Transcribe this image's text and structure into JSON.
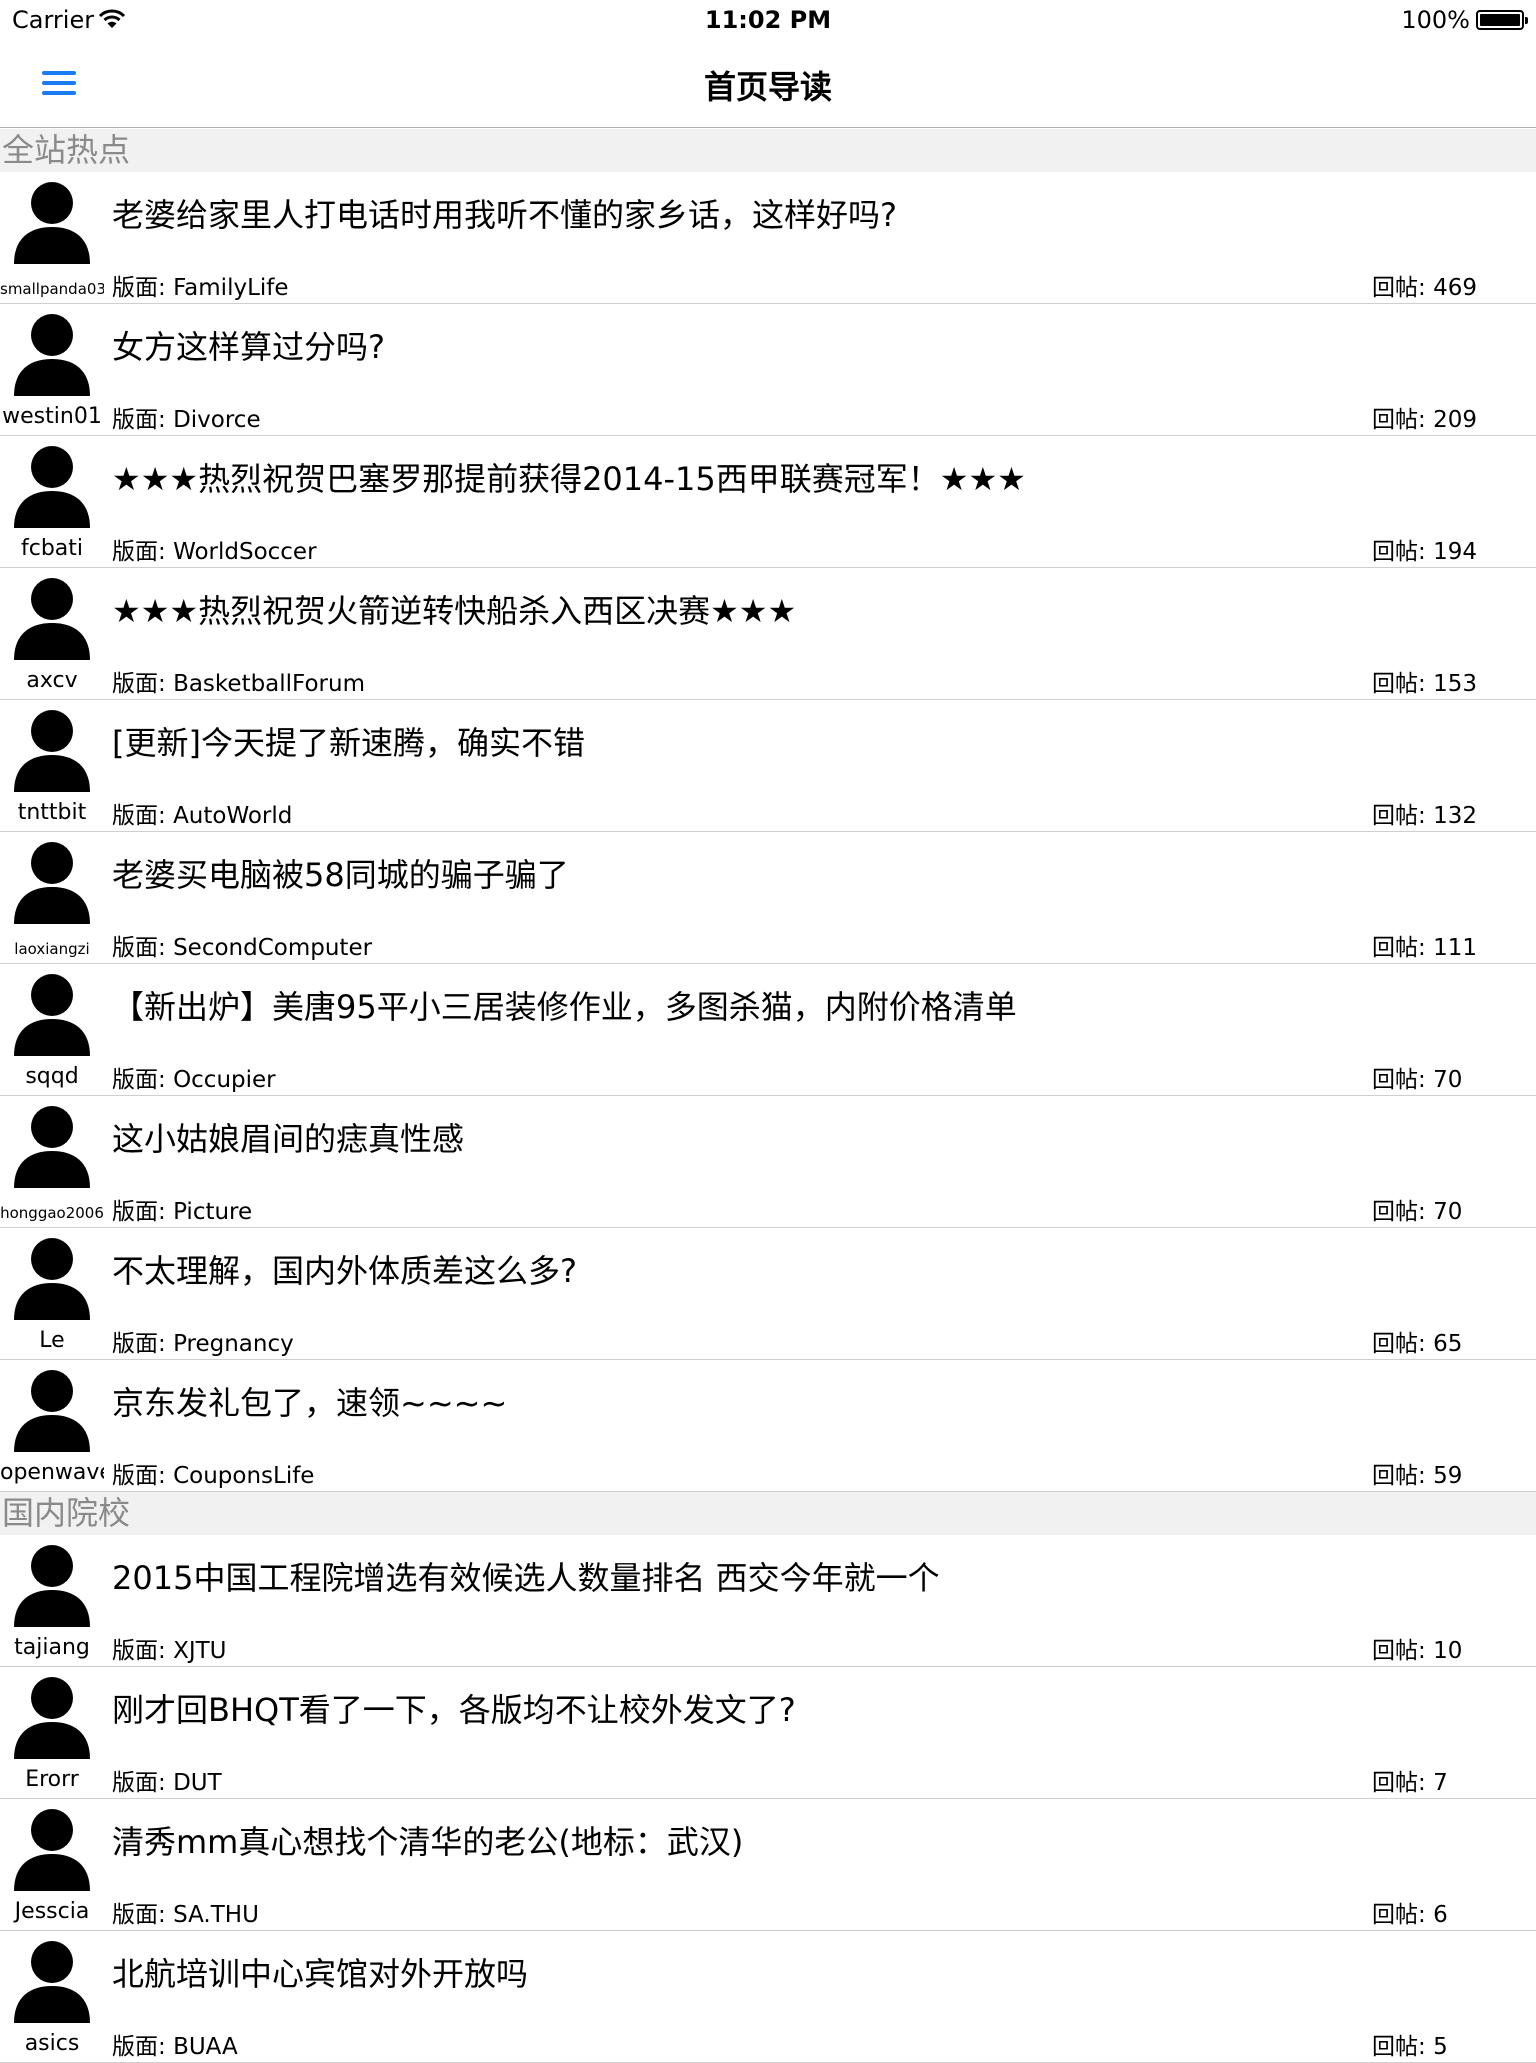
{
  "status_bar": {
    "carrier": "Carrier",
    "time": "11:02 PM",
    "battery": "100%"
  },
  "nav": {
    "title": "首页导读"
  },
  "labels": {
    "board_prefix": "版面: ",
    "replies_prefix": "回帖: "
  },
  "sections": [
    {
      "header": "全站热点",
      "rows": [
        {
          "user": "smallpanda03",
          "title": "老婆给家里人打电话时用我听不懂的家乡话，这样好吗?",
          "board": "FamilyLife",
          "replies": "469"
        },
        {
          "user": "westin01",
          "title": "女方这样算过分吗?",
          "board": "Divorce",
          "replies": "209"
        },
        {
          "user": "fcbati",
          "title": "★★★热烈祝贺巴塞罗那提前获得2014-15西甲联赛冠军！★★★",
          "board": "WorldSoccer",
          "replies": "194"
        },
        {
          "user": "axcv",
          "title": "★★★热烈祝贺火箭逆转快船杀入西区决赛★★★",
          "board": "BasketballForum",
          "replies": "153"
        },
        {
          "user": "tnttbit",
          "title": "[更新]今天提了新速腾，确实不错",
          "board": "AutoWorld",
          "replies": "132"
        },
        {
          "user": "laoxiangzi",
          "title": "老婆买电脑被58同城的骗子骗了",
          "board": "SecondComputer",
          "replies": "111"
        },
        {
          "user": "sqqd",
          "title": "【新出炉】美唐95平小三居装修作业，多图杀猫，内附价格清单",
          "board": "Occupier",
          "replies": "70"
        },
        {
          "user": "honggao2006",
          "title": "这小姑娘眉间的痣真性感",
          "board": "Picture",
          "replies": "70"
        },
        {
          "user": "Le",
          "title": "不太理解，国内外体质差这么多?",
          "board": "Pregnancy",
          "replies": "65"
        },
        {
          "user": "openwave",
          "title": "京东发礼包了，速领~~~~",
          "board": "CouponsLife",
          "replies": "59"
        }
      ]
    },
    {
      "header": "国内院校",
      "rows": [
        {
          "user": "tajiang",
          "title": "2015中国工程院增选有效候选人数量排名 西交今年就一个",
          "board": "XJTU",
          "replies": "10"
        },
        {
          "user": "Erorr",
          "title": "刚才回BHQT看了一下，各版均不让校外发文了?",
          "board": "DUT",
          "replies": "7"
        },
        {
          "user": "Jesscia",
          "title": "清秀mm真心想找个清华的老公(地标：武汉)",
          "board": "SA.THU",
          "replies": "6"
        },
        {
          "user": "asics",
          "title": "北航培训中心宾馆对外开放吗",
          "board": "BUAA",
          "replies": "5"
        }
      ]
    }
  ]
}
